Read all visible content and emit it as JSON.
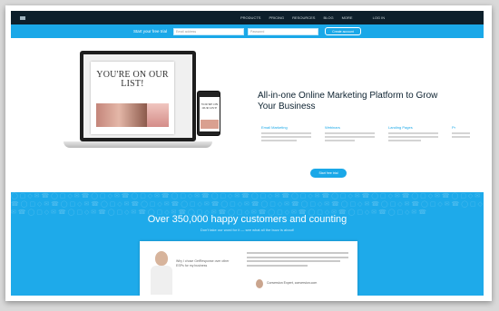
{
  "nav": {
    "links": [
      "PRODUCTS",
      "PRICING",
      "RESOURCES",
      "BLOG",
      "MORE"
    ],
    "login": "LOG IN"
  },
  "signup": {
    "label": "Start your free trial",
    "email_placeholder": "Email address",
    "password_placeholder": "Password",
    "button": "Create account"
  },
  "hero": {
    "laptop_headline": "YOU'RE ON OUR LIST!",
    "phone_headline": "YOU'RE ON OUR LIST!",
    "title": "All-in-one Online Marketing Platform to Grow Your Business",
    "features": [
      {
        "title": "Email Marketing"
      },
      {
        "title": "Webinars"
      },
      {
        "title": "Landing Pages"
      },
      {
        "title": "Pr"
      }
    ],
    "cta": "Start free trial"
  },
  "customers": {
    "heading": "Over 350,000 happy customers and counting",
    "sub": "Don't take our word for it — see what all the buzz is about!",
    "why": "Why I chose GetResponse over other ESPs for my business",
    "quote_name": "Conversion Expert, conversion.com"
  },
  "colors": {
    "brand": "#1aa8e8",
    "nav": "#0d1f2b"
  }
}
